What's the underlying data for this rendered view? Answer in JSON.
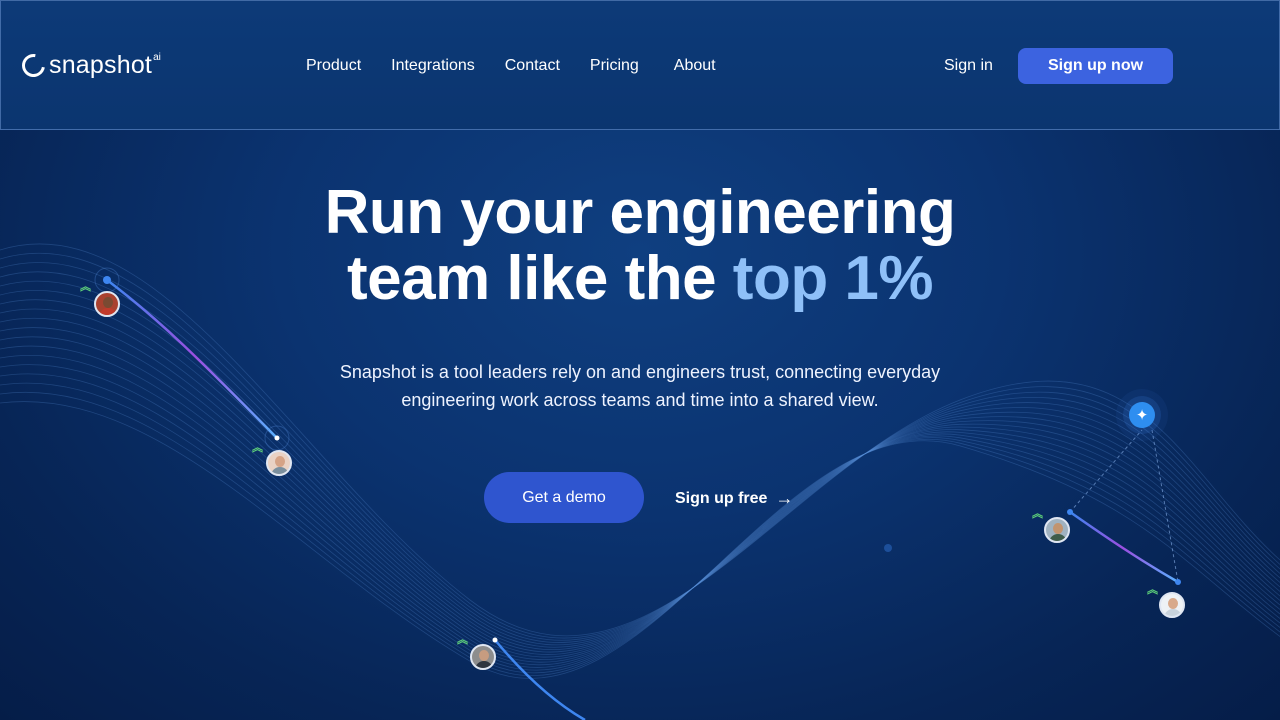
{
  "brand": {
    "name": "snapshot",
    "suffix": "ai"
  },
  "nav": {
    "links": [
      "Product",
      "Integrations",
      "Contact",
      "Pricing",
      "About"
    ],
    "signin": "Sign in",
    "signup": "Sign up now"
  },
  "hero": {
    "title_line1": "Run your engineering",
    "title_line2_plain": "team like the ",
    "title_line2_accent": "top 1%",
    "subtitle_line1": "Snapshot is a tool leaders rely on and engineers trust, connecting everyday",
    "subtitle_line2": "engineering work across teams and time into a shared view.",
    "cta_primary": "Get a demo",
    "cta_secondary": "Sign up free",
    "cta_secondary_icon": "arrow-right-icon"
  },
  "decor": {
    "avatars": [
      "avatar-engineer-1",
      "avatar-engineer-2",
      "avatar-engineer-3",
      "avatar-engineer-4",
      "avatar-engineer-5"
    ],
    "sparkle_icon": "sparkle-icon",
    "chevron_icon": "double-chevron-up-icon"
  },
  "colors": {
    "background": "#0b3370",
    "accent_text": "#8fc0f8",
    "primary_button": "#3c63e0",
    "demo_button": "#2f55cf",
    "chevron": "#5fd27a"
  }
}
